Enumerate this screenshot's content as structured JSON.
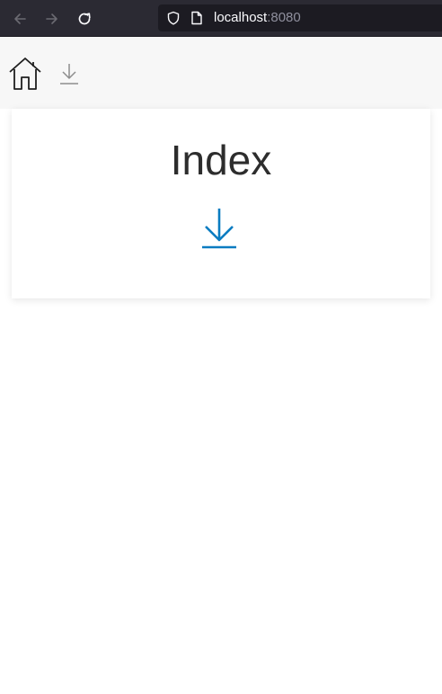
{
  "browser": {
    "url_host": "localhost",
    "url_port": ":8080",
    "icons": {
      "back": "arrow-left-icon",
      "forward": "arrow-right-icon",
      "reload": "reload-icon",
      "tracking": "shield-icon",
      "page": "page-icon"
    }
  },
  "toolbar": {
    "icons": {
      "home": "home-icon",
      "download": "download-icon"
    }
  },
  "card": {
    "title": "Index",
    "icon": "download-icon"
  },
  "colors": {
    "browser_bg": "#2b2a33",
    "urlbar_bg": "#1c1b22",
    "page_top_bg": "#f7f7f7",
    "accent": "#0a7cc1",
    "title_text": "#2d2d2d"
  }
}
